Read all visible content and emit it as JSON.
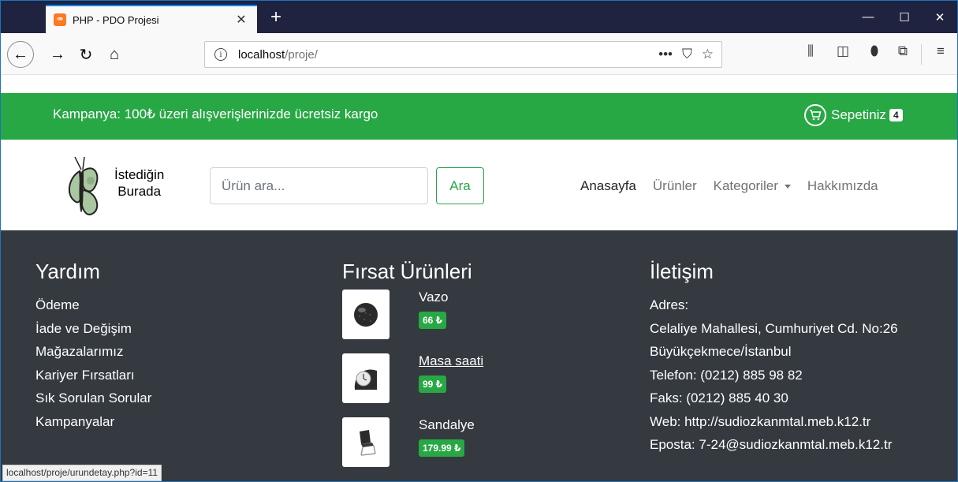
{
  "browser": {
    "tab_title": "PHP - PDO Projesi",
    "tab_close": "✕",
    "new_tab": "+",
    "url_host": "localhost",
    "url_path": "/proje/",
    "status_url": "localhost/proje/urundetay.php?id=11",
    "icons": [
      "back-icon",
      "forward-icon",
      "reload-icon",
      "home-icon",
      "info-icon",
      "more-icon",
      "pocket-icon",
      "bookmark-star-icon",
      "library-icon",
      "sidebar-icon",
      "shield-icon",
      "screenshot-icon",
      "menu-icon"
    ]
  },
  "promo": {
    "text": "Kampanya: 100₺ üzeri alışverişlerinizde ücretsiz kargo",
    "cart_label": "Sepetiniz",
    "cart_count": "4"
  },
  "header": {
    "logo_line1": "İstediğin",
    "logo_line2": "Burada",
    "search_placeholder": "Ürün ara...",
    "search_button": "Ara",
    "nav": {
      "home": "Anasayfa",
      "products": "Ürünler",
      "categories": "Kategoriler",
      "about": "Hakkımızda"
    }
  },
  "footer": {
    "help": {
      "title": "Yardım",
      "items": [
        "Ödeme",
        "İade ve Değişim",
        "Mağazalarımız",
        "Kariyer Fırsatları",
        "Sık Sorulan Sorular",
        "Kampanyalar"
      ]
    },
    "deals": {
      "title": "Fırsat Ürünleri",
      "products": [
        {
          "name": "Vazo",
          "price": "66 ₺"
        },
        {
          "name": "Masa saati",
          "price": "99 ₺"
        },
        {
          "name": "Sandalye",
          "price": "179.99 ₺"
        }
      ]
    },
    "contact": {
      "title": "İletişim",
      "address_label": "Adres:",
      "address_line1": "Celaliye Mahallesi, Cumhuriyet Cd. No:26",
      "address_line2": "Büyükçekmece/İstanbul",
      "phone": "Telefon: (0212) 885 98 82",
      "fax": "Faks: (0212) 885 40 30",
      "web": "Web: http://sudiozkanmtal.meb.k12.tr",
      "email": "Eposta: 7-24@sudiozkanmtal.meb.k12.tr"
    }
  },
  "colors": {
    "brand_green": "#28a745",
    "footer_bg": "#343a40",
    "titlebar_bg": "#202340"
  }
}
